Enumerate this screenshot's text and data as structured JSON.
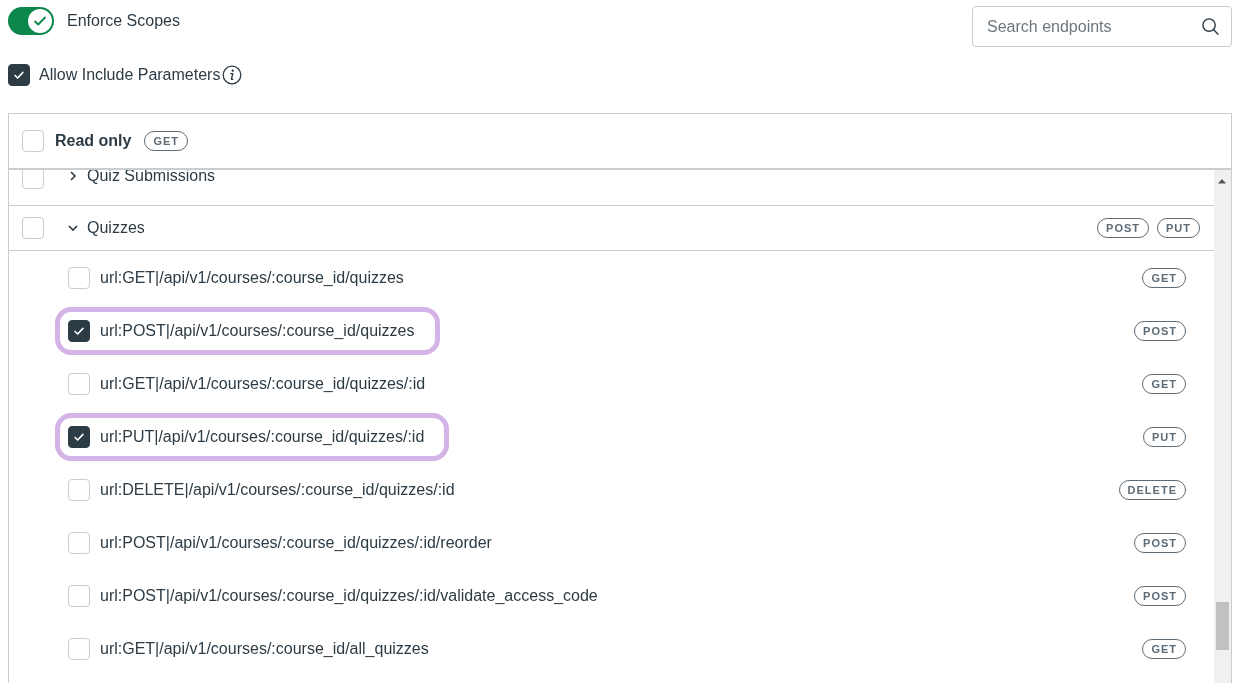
{
  "enforce_scopes": {
    "label": "Enforce Scopes",
    "on": true
  },
  "allow_include": {
    "label": "Allow Include Parameters",
    "checked": true
  },
  "search": {
    "placeholder": "Search endpoints"
  },
  "read_only": {
    "label": "Read only",
    "checked": false,
    "method": "GET"
  },
  "groups": [
    {
      "name": "Quiz Submissions",
      "checked": false,
      "expanded": false
    },
    {
      "name": "Quizzes",
      "checked": false,
      "expanded": true,
      "methods": [
        "POST",
        "PUT"
      ],
      "endpoints": [
        {
          "path": "url:GET|/api/v1/courses/:course_id/quizzes",
          "method": "GET",
          "checked": false
        },
        {
          "path": "url:POST|/api/v1/courses/:course_id/quizzes",
          "method": "POST",
          "checked": true
        },
        {
          "path": "url:GET|/api/v1/courses/:course_id/quizzes/:id",
          "method": "GET",
          "checked": false
        },
        {
          "path": "url:PUT|/api/v1/courses/:course_id/quizzes/:id",
          "method": "PUT",
          "checked": true
        },
        {
          "path": "url:DELETE|/api/v1/courses/:course_id/quizzes/:id",
          "method": "DELETE",
          "checked": false
        },
        {
          "path": "url:POST|/api/v1/courses/:course_id/quizzes/:id/reorder",
          "method": "POST",
          "checked": false
        },
        {
          "path": "url:POST|/api/v1/courses/:course_id/quizzes/:id/validate_access_code",
          "method": "POST",
          "checked": false
        },
        {
          "path": "url:GET|/api/v1/courses/:course_id/all_quizzes",
          "method": "GET",
          "checked": false
        }
      ]
    }
  ]
}
